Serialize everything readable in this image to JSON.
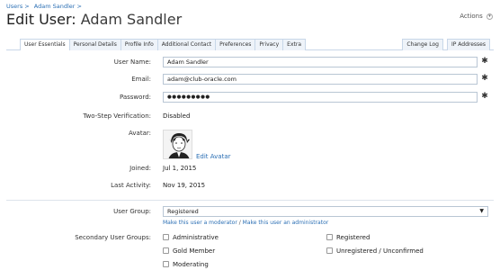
{
  "breadcrumb": [
    "Users >",
    "Adam Sandler >"
  ],
  "title": {
    "prefix": "Edit User:",
    "name": "Adam Sandler"
  },
  "actions": {
    "label": "Actions"
  },
  "tabs_left": [
    "User Essentials",
    "Personal Details",
    "Profile Info",
    "Additional Contact",
    "Preferences",
    "Privacy",
    "Extra"
  ],
  "tabs_right": [
    "Change Log",
    "IP Addresses"
  ],
  "form": {
    "username": {
      "label": "User Name:",
      "value": "Adam Sandler"
    },
    "email": {
      "label": "Email:",
      "value": "adam@club-oracle.com"
    },
    "password": {
      "label": "Password:",
      "value": "●●●●●●●●●"
    },
    "two_step": {
      "label": "Two-Step Verification:",
      "value": "Disabled"
    },
    "avatar": {
      "label": "Avatar:",
      "edit_label": "Edit Avatar"
    },
    "joined": {
      "label": "Joined:",
      "value": "Jul 1, 2015"
    },
    "last_activity": {
      "label": "Last Activity:",
      "value": "Nov 19, 2015"
    },
    "user_group": {
      "label": "User Group:",
      "value": "Registered",
      "link_moderator": "Make this user a moderator",
      "separator": "/",
      "link_admin": "Make this user an administrator"
    },
    "secondary_groups": {
      "label": "Secondary User Groups:",
      "options": [
        "Administrative",
        "Registered",
        "Gold Member",
        "Unregistered / Unconfirmed",
        "Moderating"
      ]
    }
  },
  "colors": {
    "link": "#2b6fb4",
    "tab_bg": "#eef3f9",
    "border": "#c8d7e8"
  },
  "icons": {
    "field_icon": "keyboard-icon",
    "actions_caret": "chevron-down-icon"
  }
}
